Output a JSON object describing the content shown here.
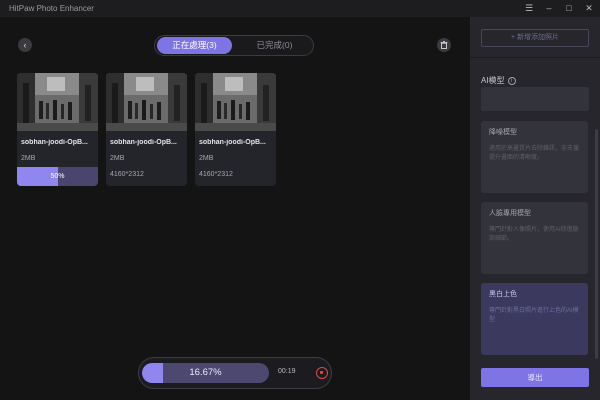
{
  "window": {
    "title": "HitPaw Photo Enhancer",
    "controls": [
      "☰",
      "–",
      "□",
      "✕"
    ]
  },
  "tabs": [
    {
      "label": "正在處理(3)",
      "active": true
    },
    {
      "label": "已完成(0)",
      "active": false
    }
  ],
  "items": [
    {
      "name": "sobhan-joodi-OpB...",
      "size": "2MB",
      "dims": "",
      "progress": 0.5,
      "progress_label": "50%"
    },
    {
      "name": "sobhan-joodi-OpB...",
      "size": "2MB",
      "dims": "4160*2312"
    },
    {
      "name": "sobhan-joodi-OpB...",
      "size": "2MB",
      "dims": "4160*2312"
    }
  ],
  "overall": {
    "progress": 0.1667,
    "progress_label": "16.67%",
    "time": "00:19"
  },
  "sidebar": {
    "add_label": "+ 新增添加照片",
    "ai_label": "AI模型",
    "models": [
      {
        "title": "降噪模型",
        "desc": "適用於高畫質片去除雜訊，亦支援提升畫面的清晰度。"
      },
      {
        "title": "人臉專用模型",
        "desc": "專門針對人像照片，使用AI修復臉部細節。"
      },
      {
        "title": "黑白上色",
        "desc": "專門針對黑白照片進行上色的AI模型"
      }
    ],
    "export_label": "導出"
  },
  "colors": {
    "accent": "#7e74e6",
    "background": "#141414",
    "panel": "#26262c",
    "stop": "#e04848"
  }
}
